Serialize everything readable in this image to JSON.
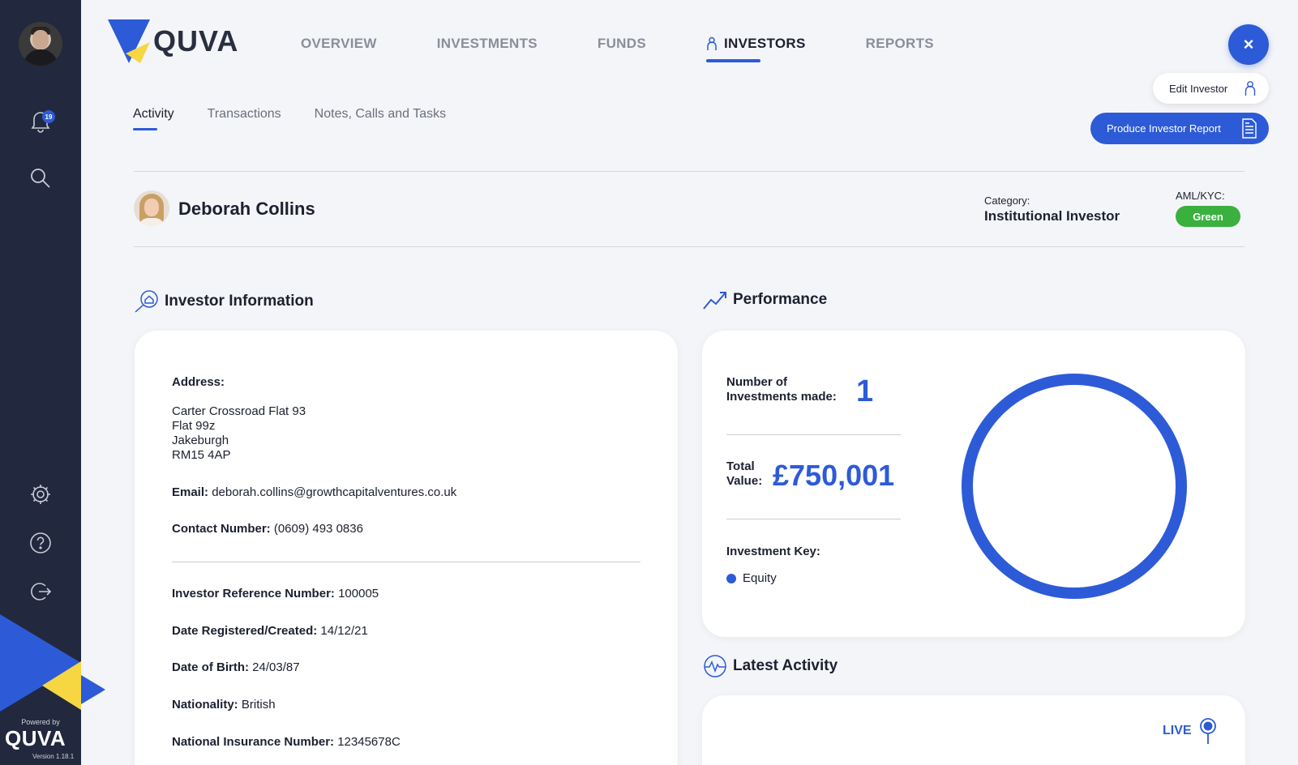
{
  "sidebar": {
    "notification_count": "19",
    "powered_by": "Powered by",
    "powered_logo": "QUVA",
    "version": "Version 1.18.1"
  },
  "header": {
    "logo_text": "QUVA",
    "nav": [
      {
        "label": "OVERVIEW"
      },
      {
        "label": "INVESTMENTS"
      },
      {
        "label": "FUNDS"
      },
      {
        "label": "INVESTORS"
      },
      {
        "label": "REPORTS"
      }
    ],
    "close_label": "×",
    "edit_label": "Edit Investor",
    "report_label": "Produce Investor Report"
  },
  "subtabs": [
    {
      "label": "Activity"
    },
    {
      "label": "Transactions"
    },
    {
      "label": "Notes, Calls and Tasks"
    }
  ],
  "investor": {
    "name": "Deborah Collins",
    "category_label": "Category:",
    "category_value": "Institutional Investor",
    "aml_label": "AML/KYC:",
    "aml_value": "Green"
  },
  "info": {
    "heading": "Investor Information",
    "address_label": "Address:",
    "address_lines": [
      "Carter Crossroad Flat 93",
      "Flat 99z",
      "Jakeburgh",
      "RM15 4AP"
    ],
    "email_label": "Email:",
    "email_value": "deborah.collins@growthcapitalventures.co.uk",
    "contact_label": "Contact Number:",
    "contact_value": "(0609) 493 0836",
    "ref_label": "Investor Reference Number:",
    "ref_value": "100005",
    "registered_label": "Date Registered/Created:",
    "registered_value": "14/12/21",
    "dob_label": "Date of Birth:",
    "dob_value": "24/03/87",
    "nationality_label": "Nationality:",
    "nationality_value": "British",
    "ni_label": "National Insurance Number:",
    "ni_value": "12345678C"
  },
  "performance": {
    "heading": "Performance",
    "investments_label_1": "Number of",
    "investments_label_2": "Investments made:",
    "investments_value": "1",
    "total_label_1": "Total",
    "total_label_2": "Value:",
    "total_value": "£750,001",
    "key_label": "Investment Key:",
    "key_item": "Equity",
    "key_color": "#2d5bd7"
  },
  "activity": {
    "heading": "Latest Activity",
    "live_label": "LIVE"
  },
  "colors": {
    "accent": "#2d5bd7",
    "sidebar": "#22283d",
    "aml_green": "#3ab03e",
    "brand_yellow": "#f6d743"
  }
}
